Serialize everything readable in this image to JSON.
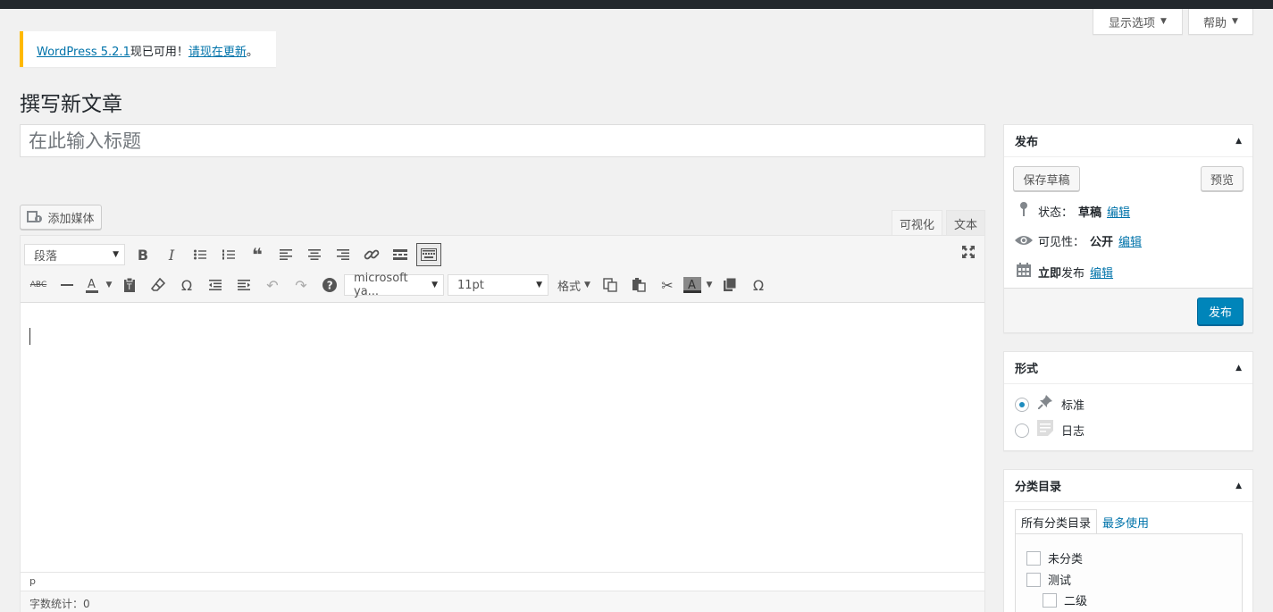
{
  "screen_meta": {
    "screen_options": "显示选项",
    "help": "帮助"
  },
  "notice": {
    "link": "WordPress 5.2.1",
    "text": "现已可用！",
    "update_link": "请现在更新",
    "end": "。"
  },
  "page_title": "撰写新文章",
  "title_placeholder": "在此输入标题",
  "add_media": "添加媒体",
  "editor_tabs": {
    "visual": "可视化",
    "text": "文本"
  },
  "toolbar": {
    "paragraph": "段落",
    "font": "microsoft ya...",
    "size": "11pt",
    "format": "格式",
    "strike_label": "ABC"
  },
  "editor": {
    "path": "p",
    "word_count": "字数统计：0"
  },
  "publish_box": {
    "title": "发布",
    "save_draft": "保存草稿",
    "preview": "预览",
    "status_label": "状态：",
    "status_value": "草稿",
    "visibility_label": "可见性：",
    "visibility_value": "公开",
    "publish_label_a": "立即",
    "publish_label_b": "发布",
    "edit": "编辑",
    "publish_button": "发布"
  },
  "format_box": {
    "title": "形式",
    "standard": "标准",
    "aside": "日志",
    "selected": "standard"
  },
  "category_box": {
    "title": "分类目录",
    "tab_all": "所有分类目录",
    "tab_popular": "最多使用",
    "items": [
      {
        "label": "未分类",
        "checked": false
      },
      {
        "label": "测试",
        "checked": false
      },
      {
        "label": "二级",
        "checked": false
      }
    ]
  },
  "colors": {
    "primary": "#0085ba",
    "link": "#0073aa",
    "notice_border": "#ffb900",
    "adminbar": "#23282d"
  }
}
